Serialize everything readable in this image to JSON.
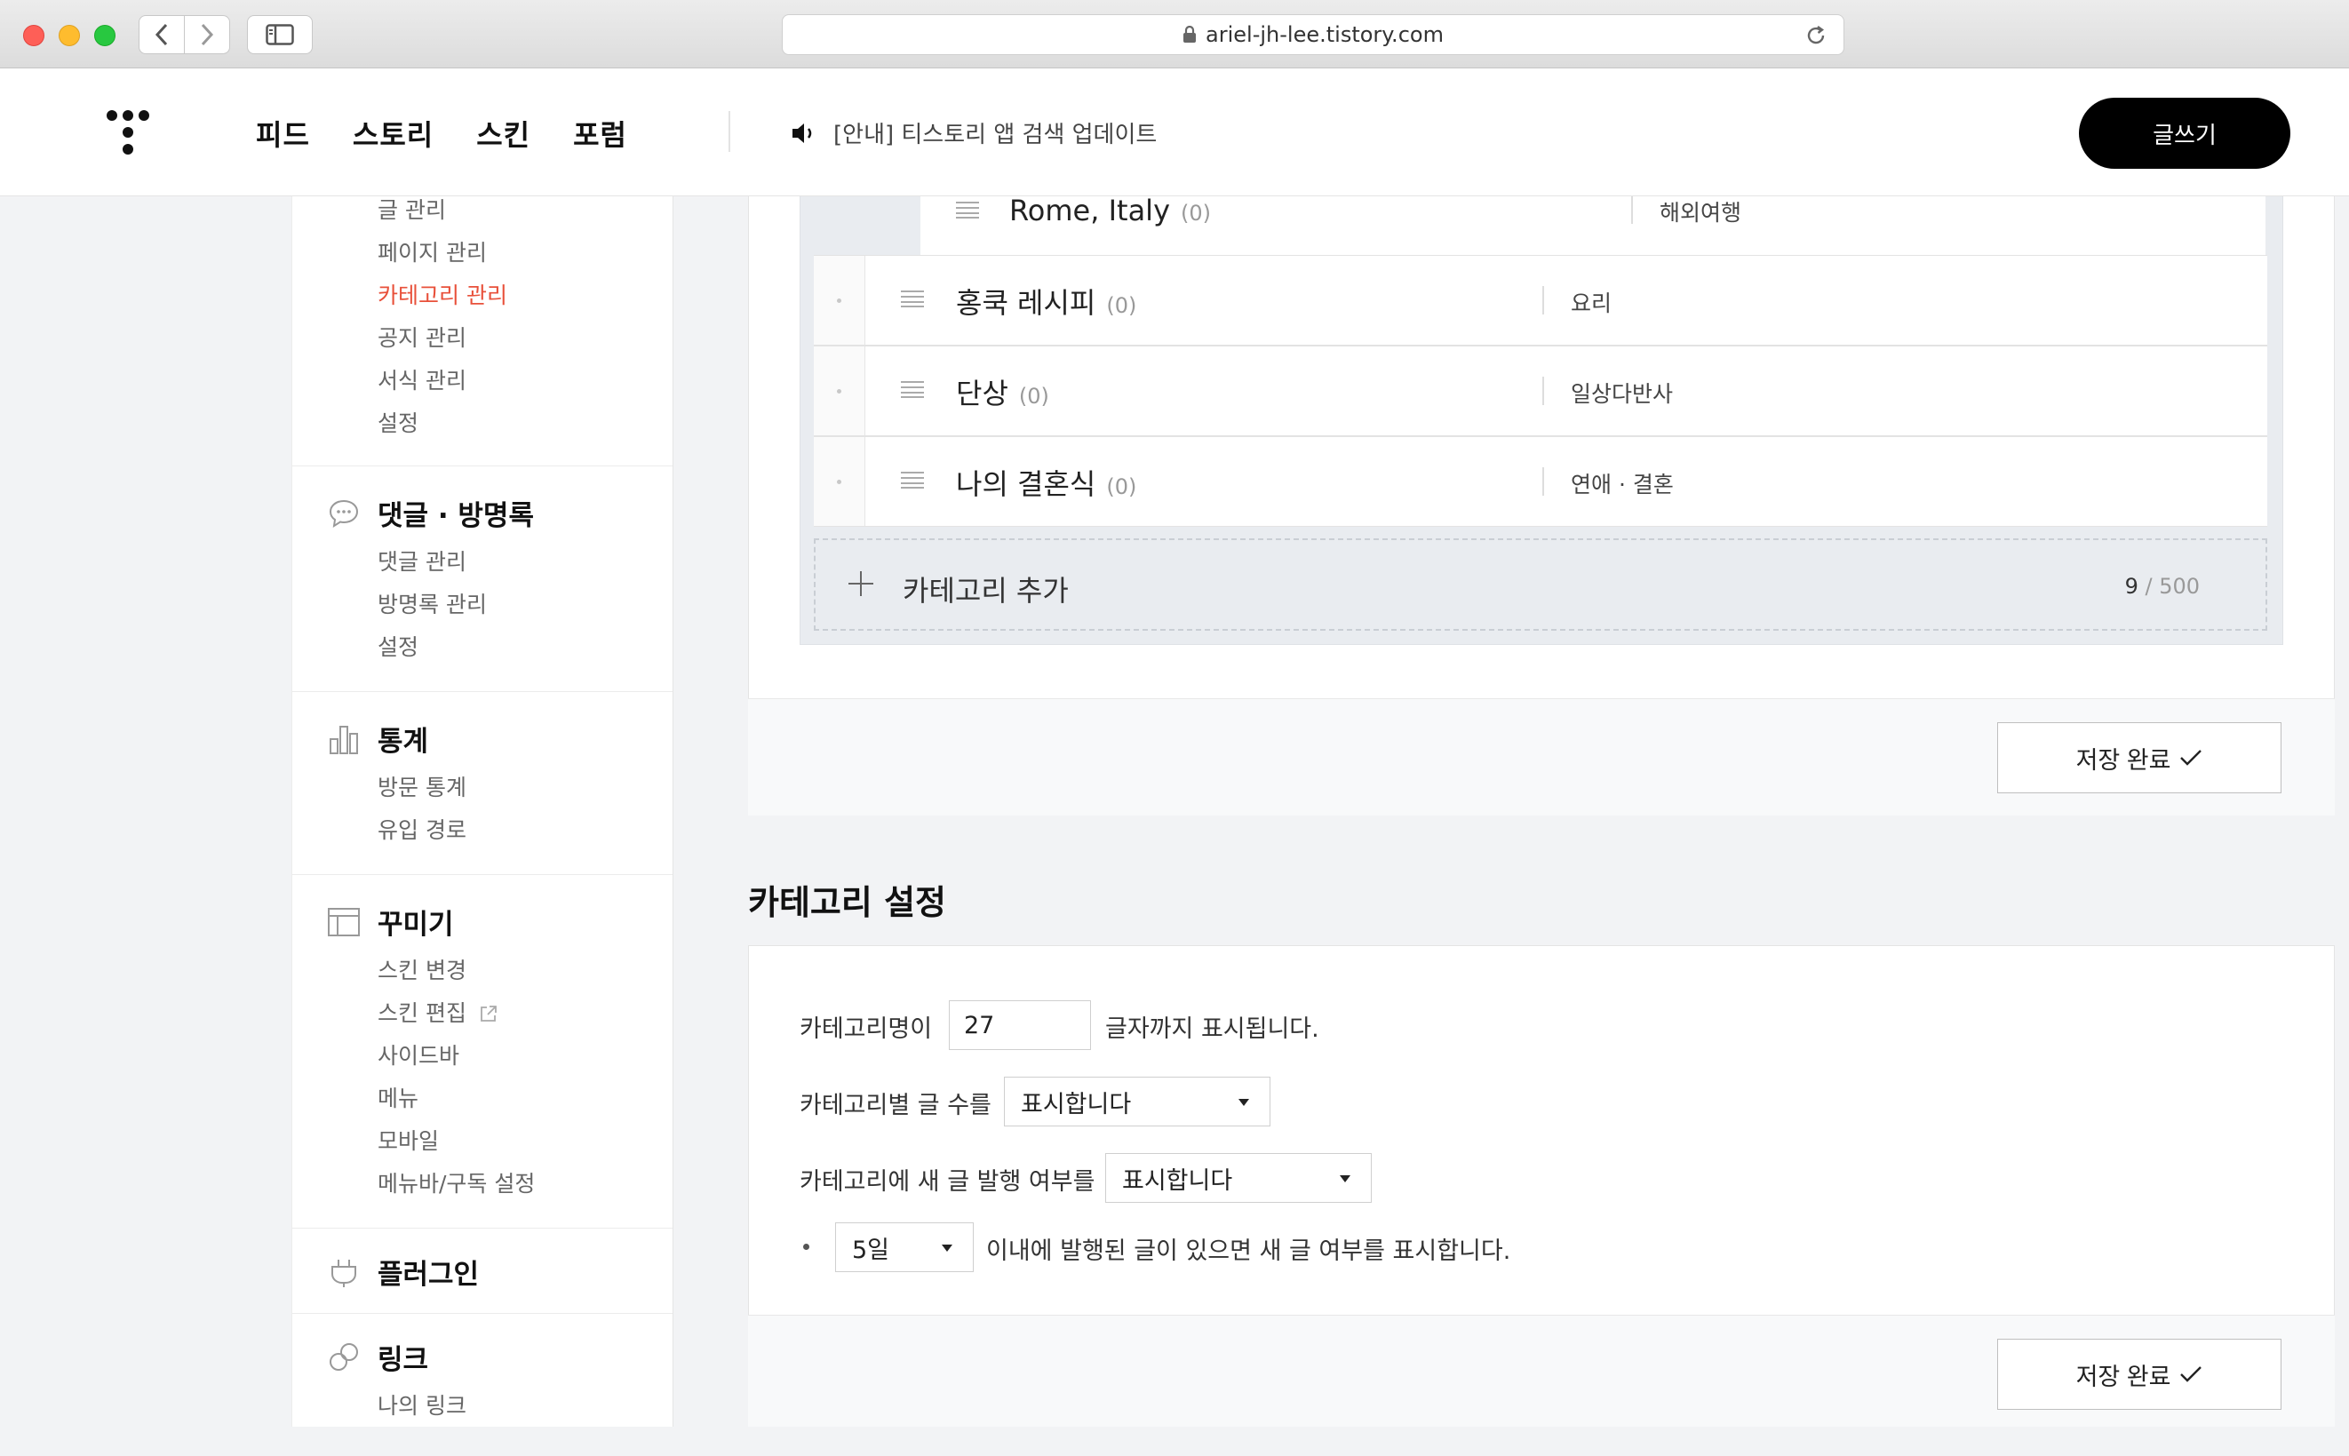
{
  "browser": {
    "url": "ariel-jh-lee.tistory.com"
  },
  "header": {
    "nav": [
      "피드",
      "스토리",
      "스킨",
      "포럼"
    ],
    "notice": "[안내] 티스토리 앱 검색 업데이트",
    "write_label": "글쓰기"
  },
  "sidebar": {
    "content_items": [
      "글 관리",
      "페이지 관리",
      "카테고리 관리",
      "공지 관리",
      "서식 관리",
      "설정"
    ],
    "active_item": "카테고리 관리",
    "comments": {
      "title": "댓글 · 방명록",
      "items": [
        "댓글 관리",
        "방명록 관리",
        "설정"
      ]
    },
    "stats": {
      "title": "통계",
      "items": [
        "방문 통계",
        "유입 경로"
      ]
    },
    "decor": {
      "title": "꾸미기",
      "items": [
        "스킨 변경",
        "스킨 편집",
        "사이드바",
        "메뉴",
        "모바일",
        "메뉴바/구독 설정"
      ]
    },
    "plugin": {
      "title": "플러그인"
    },
    "link": {
      "title": "링크",
      "items": [
        "나의 링크"
      ]
    }
  },
  "categories": {
    "rows": [
      {
        "name": "Rome, Italy",
        "count": "(0)",
        "topic": "해외여행"
      },
      {
        "name": "홍쿡 레시피",
        "count": "(0)",
        "topic": "요리"
      },
      {
        "name": "단상",
        "count": "(0)",
        "topic": "일상다반사"
      },
      {
        "name": "나의 결혼식",
        "count": "(0)",
        "topic": "연애 · 결혼"
      }
    ],
    "add_label": "카테고리 추가",
    "count_current": "9",
    "count_max": " / 500",
    "save_label": "저장 완료"
  },
  "settings": {
    "title": "카테고리 설정",
    "name_prefix": "카테고리명이",
    "name_length": "27",
    "name_suffix": "글자까지 표시됩니다.",
    "post_count_label": "카테고리별 글 수를",
    "post_count_value": "표시합니다",
    "new_post_label": "카테고리에 새 글 발행 여부를",
    "new_post_value": "표시합니다",
    "days_value": "5일",
    "days_suffix": "이내에 발행된 글이 있으면 새 글 여부를 표시합니다.",
    "save_label": "저장 완료"
  },
  "colors": {
    "active_menu": "#e8503a",
    "write_button": "#000000",
    "list_bg": "#e9ecf0"
  }
}
